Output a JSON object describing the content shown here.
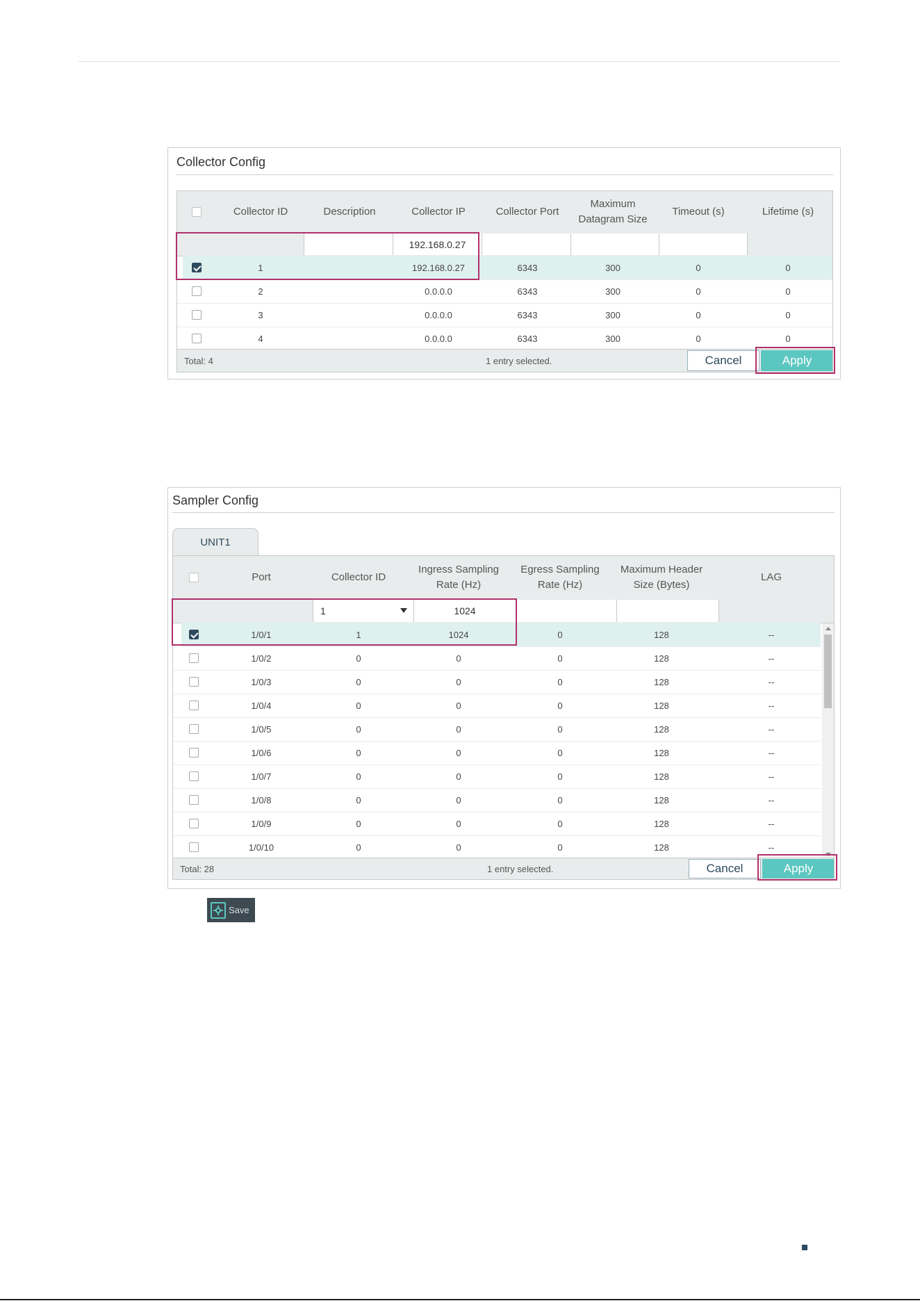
{
  "collector": {
    "title": "Collector Config",
    "headers": [
      "Collector ID",
      "Description",
      "Collector IP",
      "Collector Port",
      "Maximum Datagram Size",
      "Timeout (s)",
      "Lifetime (s)"
    ],
    "edit_row": {
      "collector_ip": "192.168.0.27"
    },
    "rows": [
      {
        "checked": true,
        "cells": [
          "1",
          "",
          "192.168.0.27",
          "6343",
          "300",
          "0",
          "0"
        ]
      },
      {
        "checked": false,
        "cells": [
          "2",
          "",
          "0.0.0.0",
          "6343",
          "300",
          "0",
          "0"
        ]
      },
      {
        "checked": false,
        "cells": [
          "3",
          "",
          "0.0.0.0",
          "6343",
          "300",
          "0",
          "0"
        ]
      },
      {
        "checked": false,
        "cells": [
          "4",
          "",
          "0.0.0.0",
          "6343",
          "300",
          "0",
          "0"
        ]
      }
    ],
    "total": "Total: 4",
    "selected": "1 entry selected.",
    "cancel": "Cancel",
    "apply": "Apply"
  },
  "sampler": {
    "title": "Sampler Config",
    "tab": "UNIT1",
    "headers": [
      "Port",
      "Collector ID",
      "Ingress Sampling Rate (Hz)",
      "Egress Sampling Rate (Hz)",
      "Maximum Header Size (Bytes)",
      "LAG"
    ],
    "edit_row": {
      "collector_id": "1",
      "ingress": "1024"
    },
    "rows": [
      {
        "checked": true,
        "cells": [
          "1/0/1",
          "1",
          "1024",
          "0",
          "128",
          "--"
        ]
      },
      {
        "checked": false,
        "cells": [
          "1/0/2",
          "0",
          "0",
          "0",
          "128",
          "--"
        ]
      },
      {
        "checked": false,
        "cells": [
          "1/0/3",
          "0",
          "0",
          "0",
          "128",
          "--"
        ]
      },
      {
        "checked": false,
        "cells": [
          "1/0/4",
          "0",
          "0",
          "0",
          "128",
          "--"
        ]
      },
      {
        "checked": false,
        "cells": [
          "1/0/5",
          "0",
          "0",
          "0",
          "128",
          "--"
        ]
      },
      {
        "checked": false,
        "cells": [
          "1/0/6",
          "0",
          "0",
          "0",
          "128",
          "--"
        ]
      },
      {
        "checked": false,
        "cells": [
          "1/0/7",
          "0",
          "0",
          "0",
          "128",
          "--"
        ]
      },
      {
        "checked": false,
        "cells": [
          "1/0/8",
          "0",
          "0",
          "0",
          "128",
          "--"
        ]
      },
      {
        "checked": false,
        "cells": [
          "1/0/9",
          "0",
          "0",
          "0",
          "128",
          "--"
        ]
      },
      {
        "checked": false,
        "cells": [
          "1/0/10",
          "0",
          "0",
          "0",
          "128",
          "--"
        ]
      }
    ],
    "total": "Total: 28",
    "selected": "1 entry selected.",
    "cancel": "Cancel",
    "apply": "Apply"
  },
  "save": {
    "label": "Save",
    "icon": "save-gear-icon",
    "accent": "#5cc7c0"
  },
  "colors": {
    "highlight": "#b0306a",
    "apply": "#5cc7c0",
    "selected_row": "#dff1ef"
  }
}
